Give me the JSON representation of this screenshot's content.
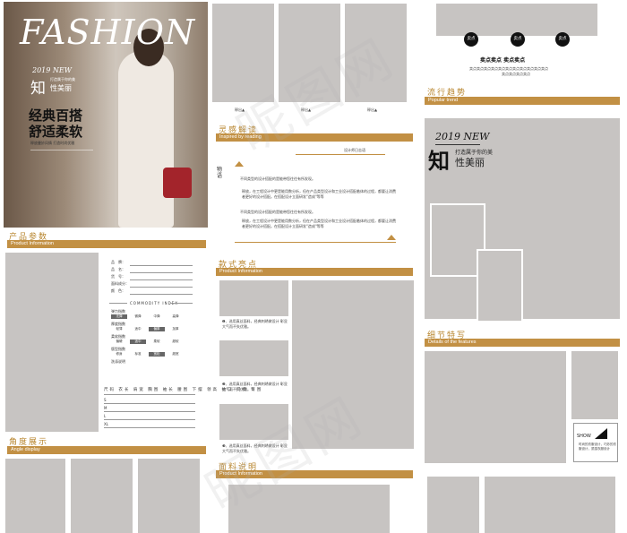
{
  "cover": {
    "brand": "FASHION",
    "new_label": "2019 NEW",
    "cn_big": "知",
    "cn_small_top": "打造属于你的美",
    "cn_small": "性美丽",
    "headline_1": "经典百搭",
    "headline_2": "舒适柔软",
    "sub": "释放曼妙风情 打造时尚优雅"
  },
  "thumbs": {
    "label_1": "释出▲",
    "label_2": "释出▲",
    "label_3": "释出▲"
  },
  "selling": {
    "dots": [
      "卖点",
      "卖点",
      "卖点"
    ],
    "title": "卖点卖点  卖点卖点",
    "line_1": "卖点卖点卖点卖点卖点卖点卖点卖点卖点卖点卖点",
    "line_2": "卖点卖点卖点卖点"
  },
  "trend": {
    "cn": "流行趋势",
    "en": "Popular trend",
    "new_label": "2019 NEW",
    "cn_big": "知",
    "cn_small_top": "打造属于你的美",
    "cn_small": "性美丽"
  },
  "inspire": {
    "cn": "灵感解读",
    "en": "Inspired by reading",
    "designer": "设计师日志语",
    "vertical": "物语",
    "p1": "不同类型的设计搭配的是能带您往往有所发现。",
    "p2": "释放，在工程设计中更是能用数分析，但在产品类型设计和工业设计搭配着体的过程，都要让消费者更好的设计搭配。在搭配设计立面研发\"造成\"等等",
    "p3": "不同类型的设计搭配的是能带您往往有所发现。",
    "p4": "释放，在工程设计中更是能用数分析，但在产品类型设计和工业设计搭配着体的过程，都要让消费者更好的设计搭配。在搭配设计立面研发\"造成\"等等"
  },
  "product": {
    "cn": "产品参数",
    "en": "Product  Information",
    "fields": [
      "品　牌：",
      "品　名：",
      "货　号：",
      "面料成分：",
      "颜　色："
    ],
    "index_title": "COMMODITY INDEX",
    "scales": [
      {
        "label": "弹力指数",
        "opts": [
          "无弹",
          "微弹",
          "中弹",
          "高弹"
        ],
        "on": 0
      },
      {
        "label": "厚度指数",
        "opts": [
          "轻薄",
          "适中",
          "偏厚",
          "加厚"
        ],
        "on": 2
      },
      {
        "label": "柔软指数",
        "opts": [
          "偏硬",
          "适中",
          "柔软",
          "超软"
        ],
        "on": 1
      },
      {
        "label": "版型指数",
        "opts": [
          "修身",
          "标准",
          "宽松",
          "超宽"
        ],
        "on": 2
      },
      {
        "label": "洗涤说明",
        "opts": [],
        "on": -1
      }
    ],
    "size_head": "尺码 衣长 肩宽 胸围 袖长 腰围 下摆 领高 袖口 门襟 臀围",
    "size_rows": [
      "S",
      "M",
      "L",
      "XL"
    ]
  },
  "style": {
    "cn": "款式亮点",
    "en": "Product  Information",
    "n1": "❶、选用真丝面料，经典刺绣做设计 彰显大气而不失优雅。",
    "n2": "❷、选用真丝面料，经典刺绣做设计 彰显大气而不失优雅。",
    "n3": "❸、选用真丝面料，经典刺绣做设计 彰显大气而不失优雅。"
  },
  "detail": {
    "cn": "细节特写",
    "en": "Details of the features",
    "show": "SHOW",
    "show_text": "时尚的衣服设计，巧妙的衣服设计，质感衣服设计"
  },
  "angle": {
    "cn": "角度展示",
    "en": "Angle display"
  },
  "fabric": {
    "cn": "面料说明",
    "en": "Product  Information"
  },
  "watermark": [
    "昵图网",
    "昵图网"
  ]
}
